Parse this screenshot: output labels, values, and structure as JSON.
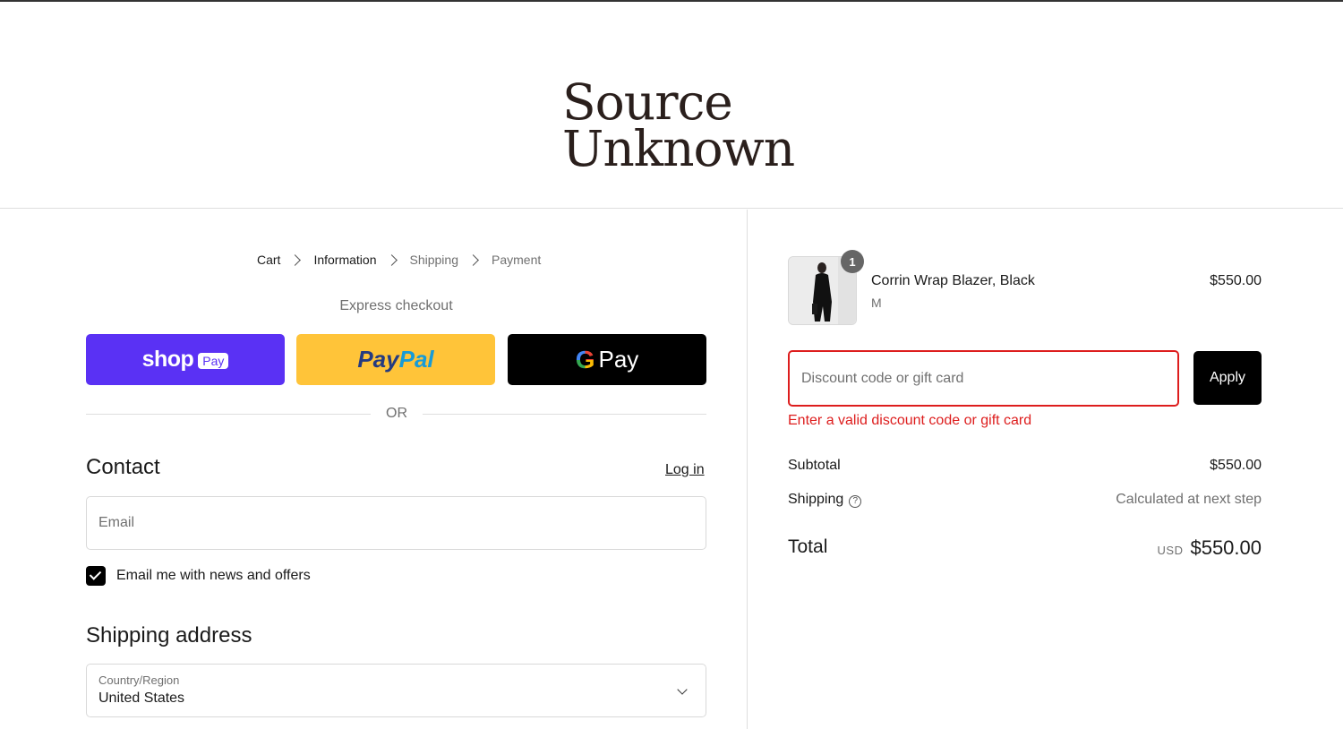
{
  "brand": {
    "line1": "Source",
    "line2": "Unknown"
  },
  "breadcrumb": {
    "cart": "Cart",
    "information": "Information",
    "shipping": "Shipping",
    "payment": "Payment"
  },
  "express": {
    "label": "Express checkout",
    "shop_word": "shop",
    "shop_badge": "Pay",
    "paypal_pay": "Pay",
    "paypal_pal": "Pal",
    "gpay_g": "G",
    "gpay_word": "Pay",
    "or_text": "OR"
  },
  "contact": {
    "title": "Contact",
    "login": "Log in",
    "email_placeholder": "Email",
    "newsletter_label": "Email me with news and offers",
    "newsletter_checked": true
  },
  "shipping_address": {
    "title": "Shipping address",
    "country_label": "Country/Region",
    "country_value": "United States"
  },
  "order": {
    "item": {
      "name": "Corrin Wrap Blazer, Black",
      "variant": "M",
      "price": "$550.00",
      "quantity": "1"
    },
    "discount": {
      "placeholder": "Discount code or gift card",
      "apply_label": "Apply",
      "error": "Enter a valid discount code or gift card"
    },
    "subtotal_label": "Subtotal",
    "subtotal_value": "$550.00",
    "shipping_label": "Shipping",
    "shipping_value": "Calculated at next step",
    "total_label": "Total",
    "currency": "USD",
    "total_value": "$550.00"
  },
  "colors": {
    "shop_pay": "#5a31f4",
    "paypal": "#ffc439",
    "gpay": "#000000",
    "error": "#dd1d1d"
  }
}
